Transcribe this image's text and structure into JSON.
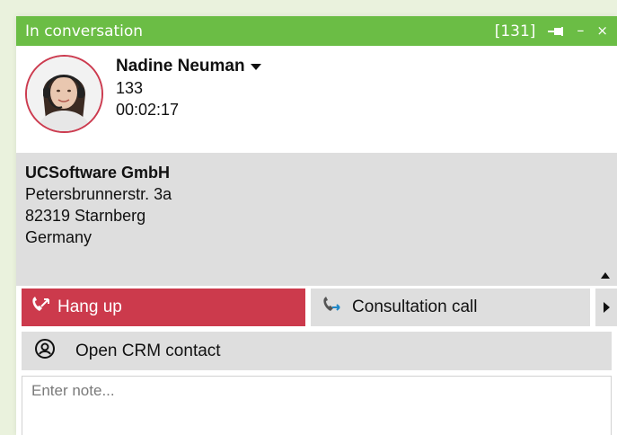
{
  "titlebar": {
    "title": "In conversation",
    "count": "[131]",
    "pin_icon": "pin-icon",
    "minimize": "–",
    "close": "×"
  },
  "caller": {
    "name": "Nadine Neuman",
    "extension": "133",
    "duration": "00:02:17"
  },
  "company": {
    "name": "UCSoftware GmbH",
    "street": "Petersbrunnerstr. 3a",
    "city": "82319 Starnberg",
    "country": "Germany"
  },
  "actions": {
    "hangup_label": "Hang up",
    "consultation_label": "Consultation call"
  },
  "crm": {
    "label": "Open CRM contact"
  },
  "note": {
    "placeholder": "Enter note..."
  },
  "colors": {
    "titlebar": "#6bbd45",
    "hangup": "#cc3a4c",
    "panel": "#dedede",
    "background": "#eaf2dd"
  }
}
